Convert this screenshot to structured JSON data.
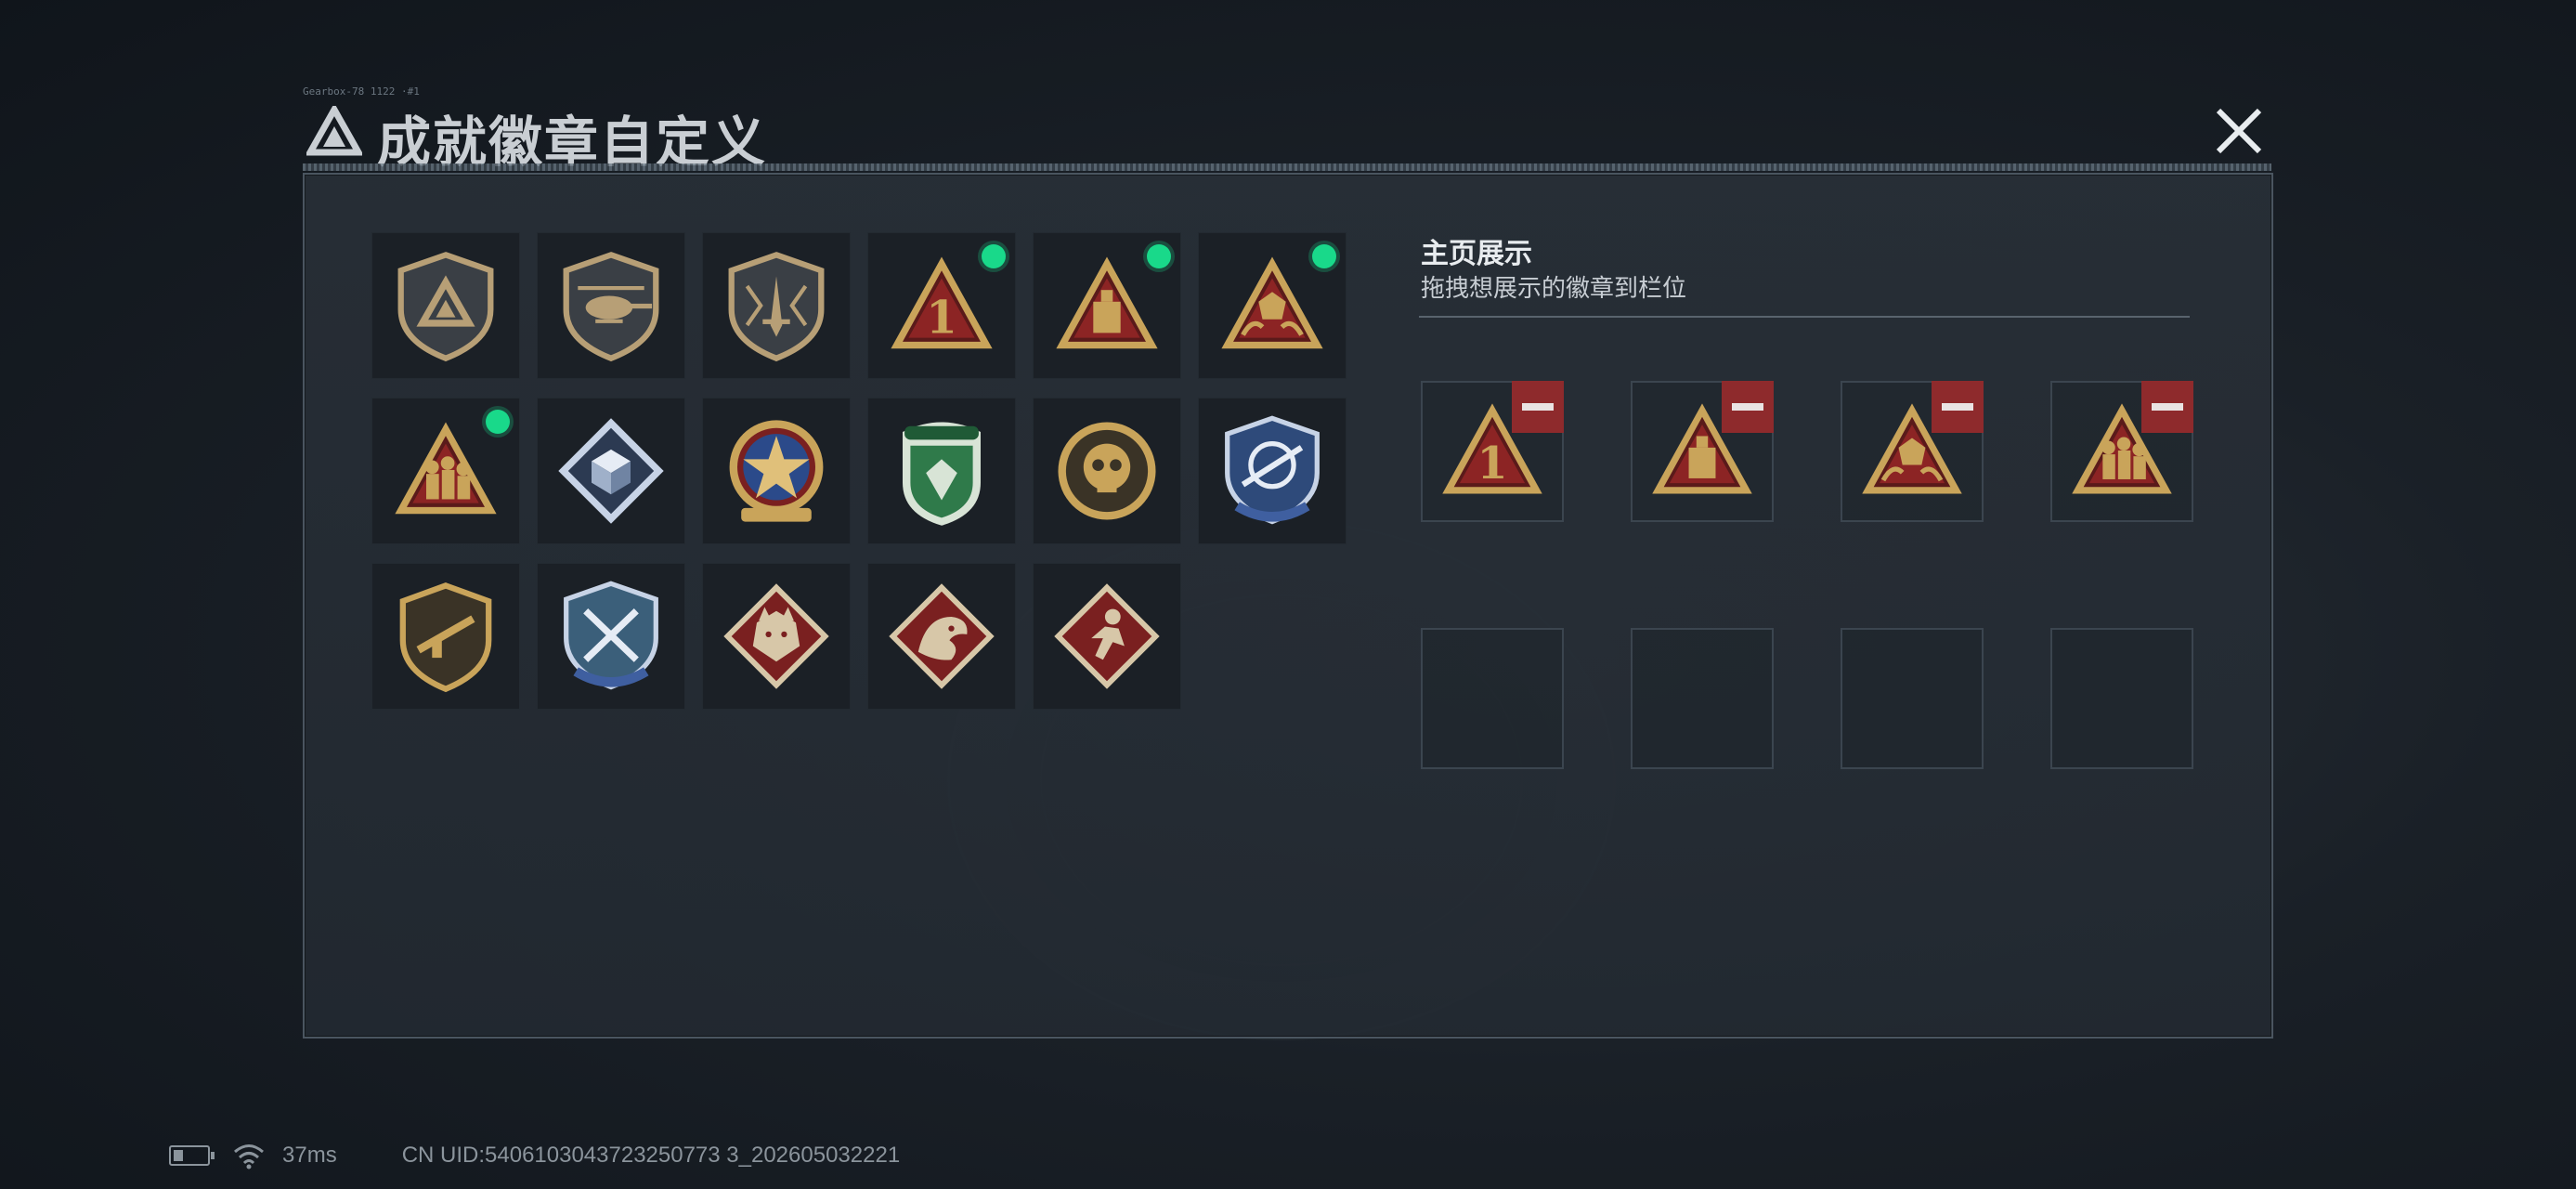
{
  "header": {
    "title": "成就徽章自定义",
    "tag": "Gearbox-78 1122 ·#1"
  },
  "showcase": {
    "title": "主页展示",
    "subtitle": "拖拽想展示的徽章到栏位"
  },
  "badges": [
    {
      "icon": "shield-delta-icon",
      "new": false
    },
    {
      "icon": "helicopter-shield-icon",
      "new": false
    },
    {
      "icon": "dagger-shield-icon",
      "new": false
    },
    {
      "icon": "triangle-number-one-icon",
      "new": true
    },
    {
      "icon": "triangle-block-icon",
      "new": true
    },
    {
      "icon": "triangle-dice-hands-icon",
      "new": true
    },
    {
      "icon": "triangle-soldiers-icon",
      "new": true
    },
    {
      "icon": "diamond-cube-icon",
      "new": false
    },
    {
      "icon": "star-medal-icon",
      "new": false
    },
    {
      "icon": "green-shield-icon",
      "new": false
    },
    {
      "icon": "gold-skull-coin-icon",
      "new": false
    },
    {
      "icon": "sniper-shield-icon",
      "new": false
    },
    {
      "icon": "rifle-shield-icon",
      "new": false
    },
    {
      "icon": "crossed-knives-shield-icon",
      "new": false
    },
    {
      "icon": "wolf-diamond-icon",
      "new": false
    },
    {
      "icon": "dragon-diamond-icon",
      "new": false
    },
    {
      "icon": "runner-diamond-icon",
      "new": false
    }
  ],
  "slots": [
    {
      "icon": "triangle-number-one-icon",
      "filled": true
    },
    {
      "icon": "triangle-block-icon",
      "filled": true
    },
    {
      "icon": "triangle-dice-hands-icon",
      "filled": true
    },
    {
      "icon": "triangle-soldiers-icon",
      "filled": true
    },
    {
      "icon": "",
      "filled": false
    },
    {
      "icon": "",
      "filled": false
    },
    {
      "icon": "",
      "filled": false
    },
    {
      "icon": "",
      "filled": false
    }
  ],
  "status": {
    "ping": "37ms",
    "uid": "CN UID:5406103043723250773 3_202605032221"
  },
  "colors": {
    "accent_new": "#19d98a",
    "remove": "#8e2a2c",
    "gold": "#c9a45a",
    "red": "#8c2424"
  }
}
